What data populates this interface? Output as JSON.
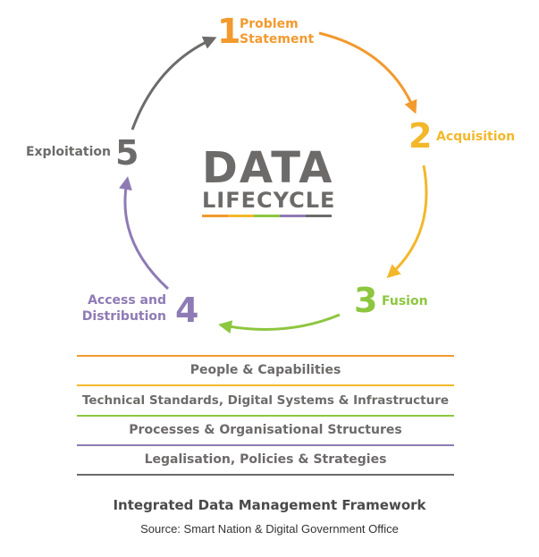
{
  "diagram": {
    "title_line1": "DATA",
    "title_line2": "LIFECYCLE",
    "stages": [
      {
        "number": "1",
        "label_line1": "Problem",
        "label_line2": "Statement",
        "color": "#f29a2e"
      },
      {
        "number": "2",
        "label_line1": "Acquisition",
        "label_line2": "",
        "color": "#f2b82a"
      },
      {
        "number": "3",
        "label_line1": "Fusion",
        "label_line2": "",
        "color": "#8dc63f"
      },
      {
        "number": "4",
        "label_line1": "Access and",
        "label_line2": "Distribution",
        "color": "#8e7bb5"
      },
      {
        "number": "5",
        "label_line1": "Exploitation",
        "label_line2": "",
        "color": "#6d6b6a"
      }
    ],
    "underline_colors": [
      "#f29a2e",
      "#f2b82a",
      "#8dc63f",
      "#8e7bb5",
      "#6d6b6a"
    ]
  },
  "framework": {
    "layers": [
      {
        "label": "People & Capabilities",
        "line_color": "#f2b82a"
      },
      {
        "label": "Technical Standards, Digital Systems & Infrastructure",
        "line_color": "#8dc63f"
      },
      {
        "label": "Processes & Organisational Structures",
        "line_color": "#8e7bb5"
      },
      {
        "label": "Legalisation, Policies & Strategies",
        "line_color": "#6d6b6a"
      }
    ],
    "top_line_color": "#f29a2e",
    "title": "Integrated Data Management Framework",
    "source": "Source: Smart Nation & Digital Government Office"
  }
}
